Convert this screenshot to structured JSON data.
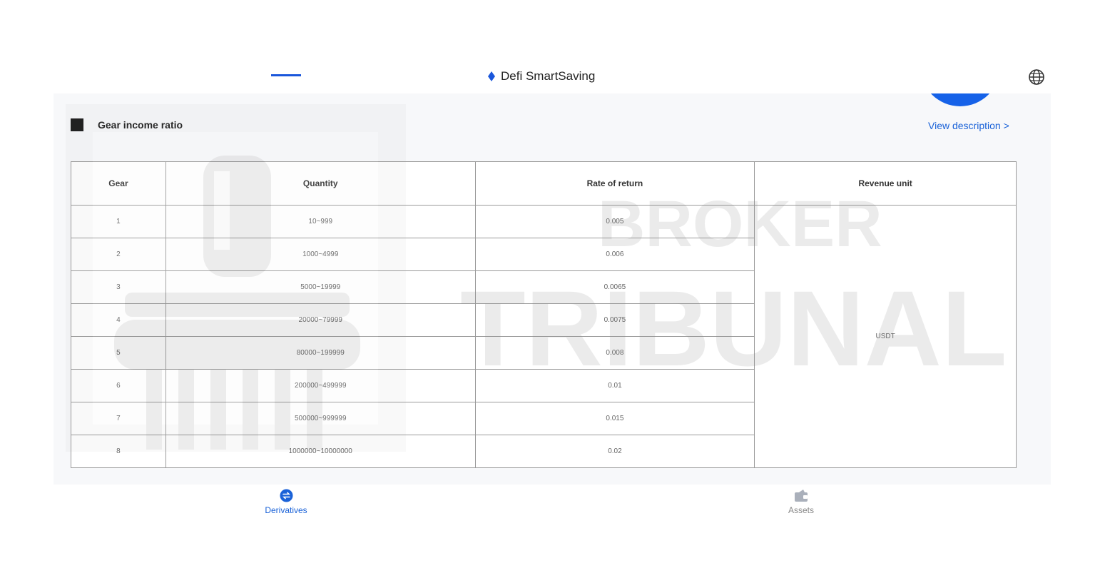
{
  "header": {
    "title": "Defi SmartSaving"
  },
  "section": {
    "title": "Gear income ratio",
    "view_description": "View description >"
  },
  "table": {
    "columns": [
      "Gear",
      "Quantity",
      "Rate of return",
      "Revenue unit"
    ],
    "rows": [
      {
        "gear": "1",
        "quantity": "10~999",
        "rate": "0.005"
      },
      {
        "gear": "2",
        "quantity": "1000~4999",
        "rate": "0.006"
      },
      {
        "gear": "3",
        "quantity": "5000~19999",
        "rate": "0.0065"
      },
      {
        "gear": "4",
        "quantity": "20000~79999",
        "rate": "0.0075"
      },
      {
        "gear": "5",
        "quantity": "80000~199999",
        "rate": "0.008"
      },
      {
        "gear": "6",
        "quantity": "200000~499999",
        "rate": "0.01"
      },
      {
        "gear": "7",
        "quantity": "500000~999999",
        "rate": "0.015"
      },
      {
        "gear": "8",
        "quantity": "1000000~10000000",
        "rate": "0.02"
      }
    ],
    "revenue_unit": "USDT"
  },
  "watermark": {
    "line1": "BROKER",
    "line2": "TRIBUNAL"
  },
  "nav": {
    "derivatives": "Derivatives",
    "assets": "Assets"
  },
  "colors": {
    "accent": "#1a62d8",
    "panel": "#f7f8fa"
  }
}
